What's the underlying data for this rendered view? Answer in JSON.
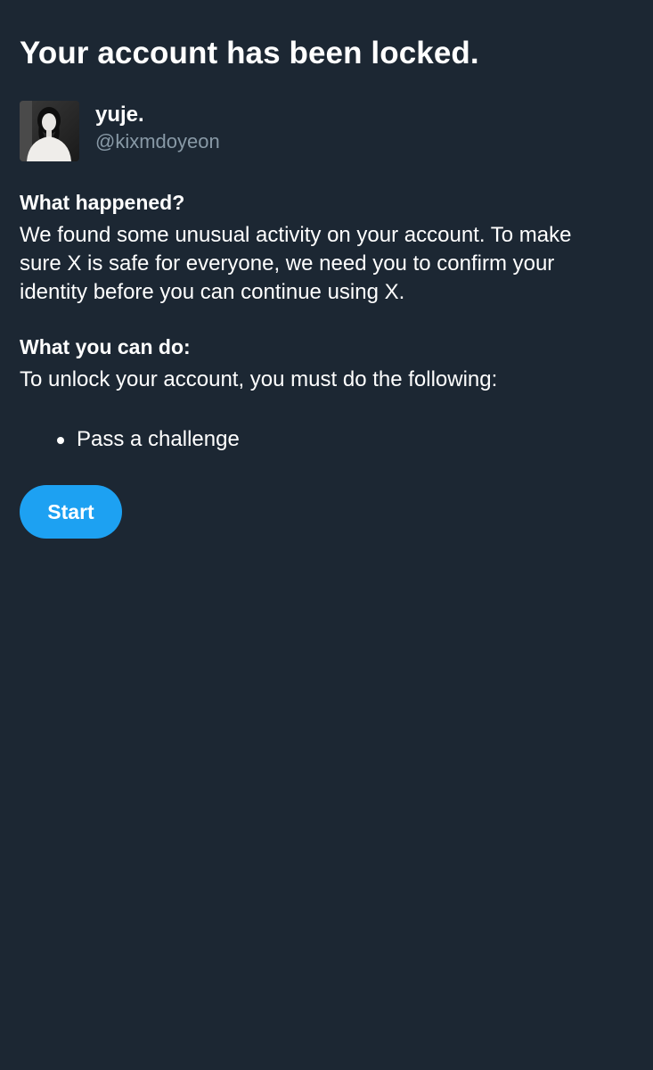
{
  "page": {
    "title": "Your account has been locked."
  },
  "account": {
    "display_name": "yuje.",
    "handle": "@kixmdoyeon"
  },
  "what_happened": {
    "heading": "What happened?",
    "lines": [
      "We found some unusual activity on your account. To make",
      "sure X is safe for everyone, we need you to confirm your",
      "identity before you can continue using X."
    ]
  },
  "what_you_can_do": {
    "heading": "What you can do:",
    "text": "To unlock your account, you must do the following:",
    "steps": [
      "Pass a challenge"
    ]
  },
  "actions": {
    "start_label": "Start"
  },
  "colors": {
    "background": "#1c2733",
    "text": "#ffffff",
    "secondary_text": "#8899a6",
    "accent": "#1da1f2"
  }
}
